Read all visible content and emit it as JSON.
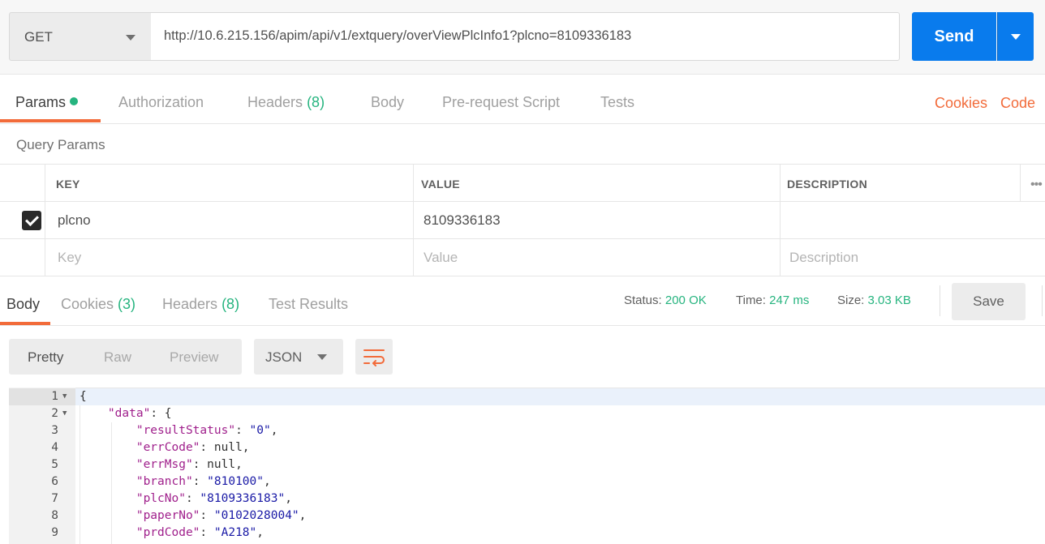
{
  "request": {
    "method": "GET",
    "url": "http://10.6.215.156/apim/api/v1/extquery/overViewPlcInfo1?plcno=8109336183",
    "send_label": "Send"
  },
  "request_tabs": {
    "params": "Params",
    "authorization": "Authorization",
    "headers": "Headers",
    "headers_count": "(8)",
    "body": "Body",
    "prerequest": "Pre-request Script",
    "tests": "Tests",
    "cookies_link": "Cookies",
    "code_link": "Code"
  },
  "query_params": {
    "title": "Query Params",
    "columns": [
      "KEY",
      "VALUE",
      "DESCRIPTION"
    ],
    "rows": [
      {
        "checked": true,
        "key": "plcno",
        "value": "8109336183",
        "description": ""
      }
    ],
    "placeholders": {
      "key": "Key",
      "value": "Value",
      "description": "Description"
    },
    "more": "•••"
  },
  "response_tabs": {
    "body": "Body",
    "cookies": "Cookies",
    "cookies_count": "(3)",
    "headers": "Headers",
    "headers_count": "(8)",
    "test_results": "Test Results"
  },
  "response_status": {
    "status_label": "Status:",
    "status_value": "200 OK",
    "time_label": "Time:",
    "time_value": "247 ms",
    "size_label": "Size:",
    "size_value": "3.03 KB",
    "save_label": "Save"
  },
  "format_toolbar": {
    "pretty": "Pretty",
    "raw": "Raw",
    "preview": "Preview",
    "language": "JSON",
    "wrap_icon": "wrap-lines-icon"
  },
  "code_lines": [
    {
      "n": "1",
      "fold": true,
      "parts": [
        {
          "t": "{",
          "c": "p"
        }
      ]
    },
    {
      "n": "2",
      "fold": true,
      "parts": [
        {
          "t": "    ",
          "c": "p"
        },
        {
          "t": "\"data\"",
          "c": "key"
        },
        {
          "t": ": {",
          "c": "p"
        }
      ]
    },
    {
      "n": "3",
      "fold": false,
      "parts": [
        {
          "t": "        ",
          "c": "p"
        },
        {
          "t": "\"resultStatus\"",
          "c": "key"
        },
        {
          "t": ": ",
          "c": "p"
        },
        {
          "t": "\"0\"",
          "c": "str"
        },
        {
          "t": ",",
          "c": "p"
        }
      ]
    },
    {
      "n": "4",
      "fold": false,
      "parts": [
        {
          "t": "        ",
          "c": "p"
        },
        {
          "t": "\"errCode\"",
          "c": "key"
        },
        {
          "t": ": null,",
          "c": "p"
        }
      ]
    },
    {
      "n": "5",
      "fold": false,
      "parts": [
        {
          "t": "        ",
          "c": "p"
        },
        {
          "t": "\"errMsg\"",
          "c": "key"
        },
        {
          "t": ": null,",
          "c": "p"
        }
      ]
    },
    {
      "n": "6",
      "fold": false,
      "parts": [
        {
          "t": "        ",
          "c": "p"
        },
        {
          "t": "\"branch\"",
          "c": "key"
        },
        {
          "t": ": ",
          "c": "p"
        },
        {
          "t": "\"810100\"",
          "c": "str"
        },
        {
          "t": ",",
          "c": "p"
        }
      ]
    },
    {
      "n": "7",
      "fold": false,
      "parts": [
        {
          "t": "        ",
          "c": "p"
        },
        {
          "t": "\"plcNo\"",
          "c": "key"
        },
        {
          "t": ": ",
          "c": "p"
        },
        {
          "t": "\"8109336183\"",
          "c": "str"
        },
        {
          "t": ",",
          "c": "p"
        }
      ]
    },
    {
      "n": "8",
      "fold": false,
      "parts": [
        {
          "t": "        ",
          "c": "p"
        },
        {
          "t": "\"paperNo\"",
          "c": "key"
        },
        {
          "t": ": ",
          "c": "p"
        },
        {
          "t": "\"0102028004\"",
          "c": "str"
        },
        {
          "t": ",",
          "c": "p"
        }
      ]
    },
    {
      "n": "9",
      "fold": false,
      "parts": [
        {
          "t": "        ",
          "c": "p"
        },
        {
          "t": "\"prdCode\"",
          "c": "key"
        },
        {
          "t": ": ",
          "c": "p"
        },
        {
          "t": "\"A218\"",
          "c": "str"
        },
        {
          "t": ",",
          "c": "p"
        }
      ]
    }
  ]
}
